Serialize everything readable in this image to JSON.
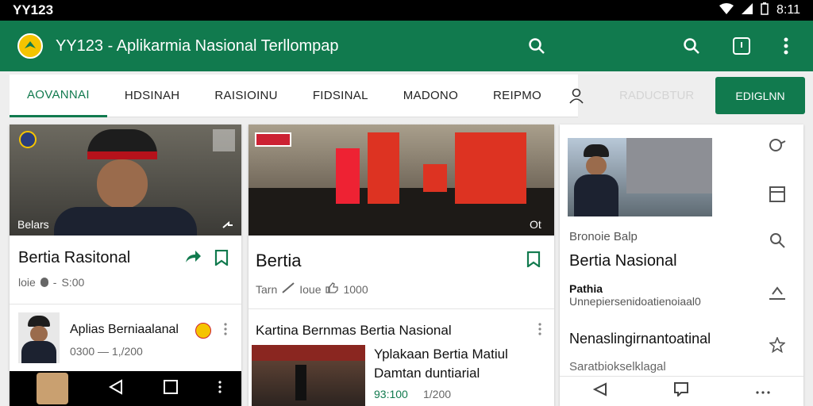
{
  "status": {
    "carrier": "YY123",
    "time": "8:11"
  },
  "app": {
    "title": "YY123 - Aplikarmia Nasional Terllompap"
  },
  "tabs": [
    "AOVANNAI",
    "HDSINAH",
    "RAISIOINU",
    "FIDSINAL",
    "MADONO",
    "REIPMO"
  ],
  "ghost_label": "RADUCBTUR",
  "cta_label": "EDIGLNN",
  "card1": {
    "overlay": "Belars",
    "title": "Bertia Rasitonal",
    "meta": "loie",
    "count": "S:00",
    "sub_title": "Aplias Berniaalanal",
    "sub_meta": "0300 — 1,/200"
  },
  "card2": {
    "overlay": "Ot",
    "title": "Bertia",
    "meta1": "Tarn",
    "meta2": "Ioue",
    "count": "1000",
    "sub_header": "Kartina Bernmas Bertia Nasional",
    "sub_line1": "Yplakaan Bertia Matiul",
    "sub_line2": "Damtan duntiarial",
    "sub_meta_a": "93:100",
    "sub_meta_b": "1/200"
  },
  "card3": {
    "kicker": "Bronoie Balp",
    "title": "Bertia Nasional",
    "sub_bold": "Pathia",
    "sub_text": "Unnepiersenidoatienoiaal0",
    "headline": "Nenaslingirnantoatinal",
    "footer": "Saratbiokselklagal"
  },
  "colors": {
    "primary": "#117a4e",
    "status_bar": "#000000",
    "accent": "#f5c400"
  },
  "icons": [
    "search-icon",
    "share-icon",
    "bookmark-icon",
    "user-icon",
    "more-icon",
    "chat-icon",
    "window-icon",
    "pin-icon",
    "star-icon",
    "back-icon",
    "home-icon"
  ]
}
